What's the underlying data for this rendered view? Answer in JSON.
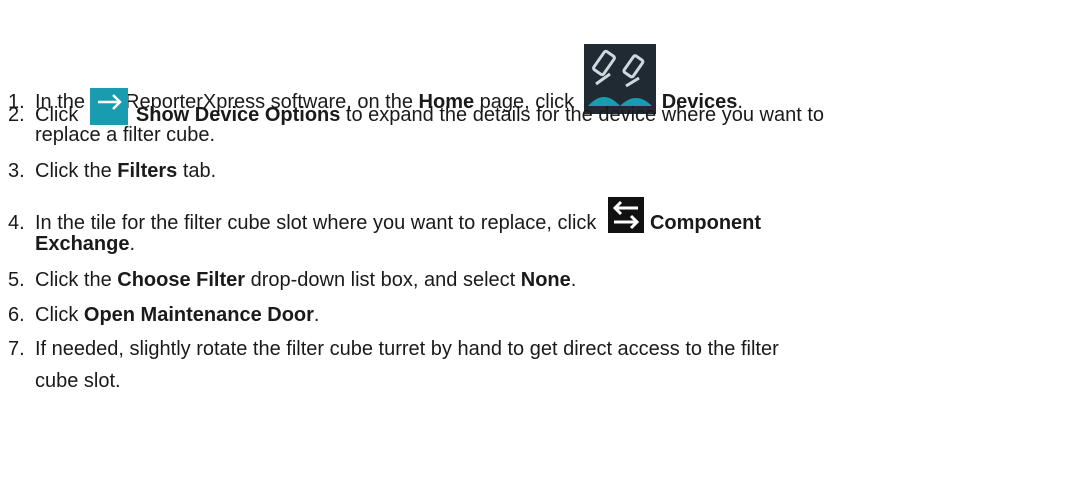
{
  "steps": [
    {
      "num": "1.",
      "a": "In the CellReporterXpress software, on the ",
      "b1": "Home",
      "c": " page, click ",
      "b2": "Devices",
      "d": ".",
      "icon": "devices-icon"
    },
    {
      "num": "2.",
      "a": "Click ",
      "b1": "Show Device Options",
      "c": " to expand the details for the device where you want to",
      "cont": "replace a filter cube.",
      "icon": "arrow-right-icon"
    },
    {
      "num": "3.",
      "a": "Click the ",
      "b1": "Filters",
      "c": " tab."
    },
    {
      "num": "4.",
      "a": "In the tile for the filter cube slot where you want to replace, click ",
      "b1": "Component",
      "cont_b": "Exchange",
      "cont_d": ".",
      "icon": "component-exchange-icon"
    },
    {
      "num": "5.",
      "a": "Click the ",
      "b1": "Choose Filter",
      "c": " drop-down list box, and select ",
      "b2": "None",
      "d": "."
    },
    {
      "num": "6.",
      "a": "Click ",
      "b1": "Open Maintenance Door",
      "d": "."
    },
    {
      "num": "7.",
      "a": "If needed, slightly rotate the filter cube turret by hand to get direct access to the filter",
      "cont": "cube slot."
    }
  ],
  "colors": {
    "accent": "#1a9cb0",
    "icon_dark": "#1f2a33"
  }
}
